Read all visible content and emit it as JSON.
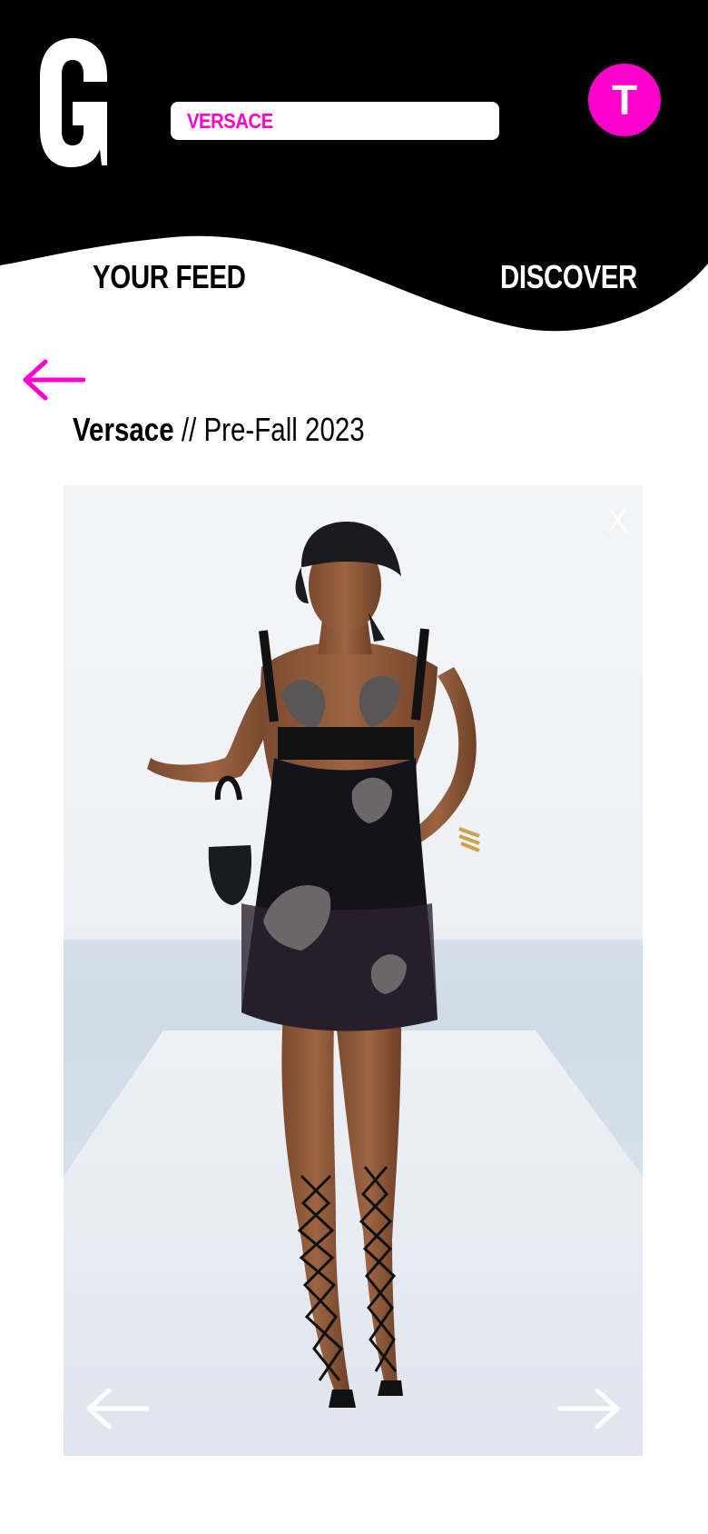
{
  "header": {
    "logo_letter": "G",
    "search": {
      "value": "VERSACE"
    },
    "avatar_initial": "T",
    "colors": {
      "accent": "#ff00cc",
      "header_bg": "#000000"
    }
  },
  "tabs": [
    {
      "label": "YOUR FEED",
      "active": true
    },
    {
      "label": "DISCOVER",
      "active": false
    }
  ],
  "detail": {
    "brand": "Versace",
    "separator": "//",
    "collection": "Pre-Fall 2023",
    "photo": {
      "alt": "Runway look: model in black headscarf and sheer black mesh mini dress with embellished butterflies, carrying small black bag, lace-up butterfly sandals",
      "close_label": "X"
    }
  },
  "icons": {
    "back": "arrow-left-icon",
    "prev": "arrow-left-icon",
    "next": "arrow-right-icon",
    "close": "close-icon"
  }
}
